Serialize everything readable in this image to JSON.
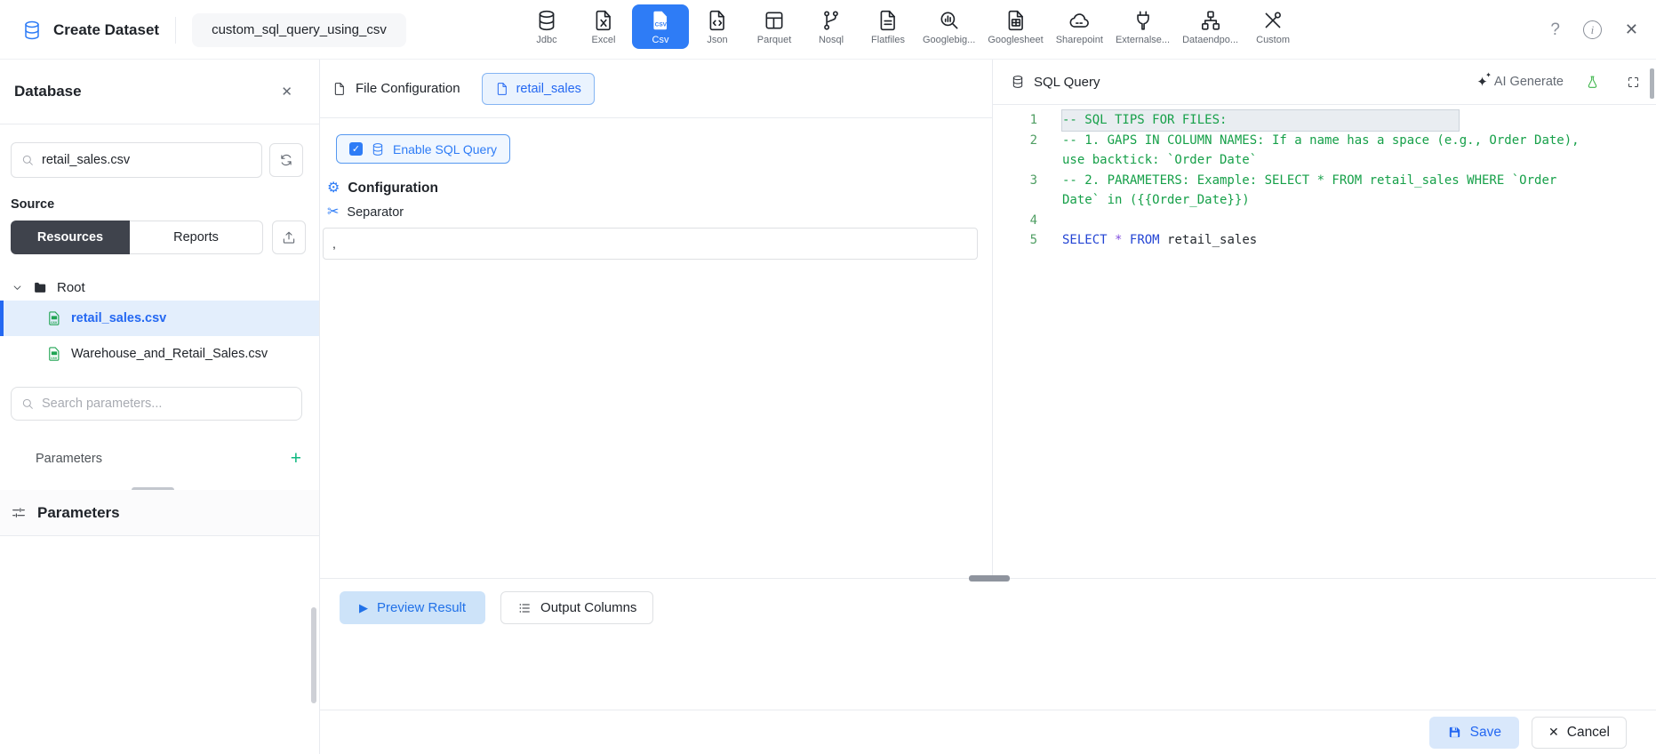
{
  "colors": {
    "accent_blue": "#2e7cf6",
    "accent_text_blue": "#2468f2",
    "resources_tab_bg": "#3f434c",
    "selected_row_bg": "#e3eefc",
    "csv_icon_green": "#21a453",
    "flask_icon_green": "#3cb54a",
    "comment_green": "#16a049",
    "keyword_blue": "#2445d4"
  },
  "icons": {
    "help": "?",
    "info": "i",
    "close": "✕",
    "gear": "⚙",
    "scissors": "✂",
    "play": "▶",
    "sparkles": "✦",
    "plus": "+",
    "check": "✓"
  },
  "topbar": {
    "app_title": "Create Dataset",
    "dataset_name": "custom_sql_query_using_csv",
    "source_types": [
      {
        "label": "Jdbc",
        "icon": "database",
        "selected": false
      },
      {
        "label": "Excel",
        "icon": "file-excel",
        "selected": false
      },
      {
        "label": "Csv",
        "icon": "file-csv",
        "selected": true
      },
      {
        "label": "Json",
        "icon": "file-json",
        "selected": false
      },
      {
        "label": "Parquet",
        "icon": "parquet-table",
        "selected": false
      },
      {
        "label": "Nosql",
        "icon": "branch",
        "selected": false
      },
      {
        "label": "Flatfiles",
        "icon": "file-lines",
        "selected": false
      },
      {
        "label": "Googlebig...",
        "icon": "search-chart",
        "selected": false
      },
      {
        "label": "Googlesheet",
        "icon": "file-table",
        "selected": false
      },
      {
        "label": "Sharepoint",
        "icon": "cloud",
        "selected": false
      },
      {
        "label": "Externalse...",
        "icon": "plug",
        "selected": false
      },
      {
        "label": "Dataendpo...",
        "icon": "network",
        "selected": false
      },
      {
        "label": "Custom",
        "icon": "tools",
        "selected": false
      }
    ]
  },
  "sidebar": {
    "title": "Database",
    "search_value": "retail_sales.csv",
    "source_label": "Source",
    "tabs": [
      {
        "label": "Resources",
        "selected": true
      },
      {
        "label": "Reports",
        "selected": false
      }
    ],
    "tree": {
      "root_label": "Root",
      "files": [
        {
          "name": "retail_sales.csv",
          "selected": true
        },
        {
          "name": "Warehouse_and_Retail_Sales.csv",
          "selected": false
        }
      ]
    },
    "parameters": {
      "title": "Parameters",
      "search_placeholder": "Search parameters...",
      "list_label": "Parameters",
      "add_label": "+"
    }
  },
  "config_panel": {
    "title": "File Configuration",
    "table_chip": "retail_sales",
    "enable_sql_label": "Enable SQL Query",
    "configuration_label": "Configuration",
    "separator_label": "Separator",
    "separator_value": ",",
    "preview_button": "Preview Result",
    "output_columns_button": "Output Columns"
  },
  "sql_panel": {
    "title": "SQL Query",
    "ai_generate_label": "AI Generate",
    "code_lines": [
      {
        "number": "1",
        "highlighted": true,
        "segments": [
          {
            "text": "-- SQL TIPS FOR FILES:",
            "type": "comment"
          }
        ]
      },
      {
        "number": "2",
        "highlighted": false,
        "segments": [
          {
            "text": "-- 1. GAPS IN COLUMN NAMES: If a name has a space (e.g., Order Date), use backtick: `Order Date`",
            "type": "comment"
          }
        ]
      },
      {
        "number": "3",
        "highlighted": false,
        "segments": [
          {
            "text": "-- 2. PARAMETERS: Example: SELECT * FROM retail_sales WHERE `Order Date` in ({{Order_Date}})",
            "type": "comment"
          }
        ]
      },
      {
        "number": "4",
        "highlighted": false,
        "segments": []
      },
      {
        "number": "5",
        "highlighted": false,
        "segments": [
          {
            "text": "SELECT",
            "type": "keyword"
          },
          {
            "text": " ",
            "type": "plain"
          },
          {
            "text": "*",
            "type": "operator"
          },
          {
            "text": " ",
            "type": "plain"
          },
          {
            "text": "FROM",
            "type": "keyword"
          },
          {
            "text": " retail_sales",
            "type": "plain"
          }
        ]
      }
    ]
  },
  "footer": {
    "save_label": "Save",
    "cancel_label": "Cancel"
  }
}
